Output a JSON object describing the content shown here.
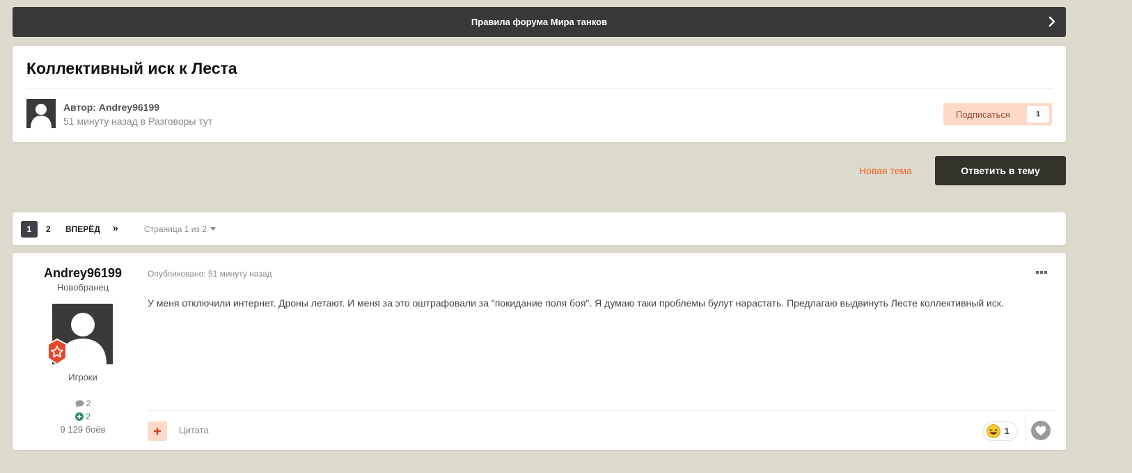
{
  "rules_bar": {
    "label": "Правила форума Мира танков"
  },
  "topic": {
    "title": "Коллективный иск к Леста",
    "author_line": "Автор: Andrey96199",
    "meta": "51 минуту назад в Разговоры тут",
    "subscribe_label": "Подписаться",
    "subscribe_count": "1"
  },
  "actions": {
    "new_topic": "Новая тема",
    "reply": "Ответить в тему"
  },
  "pagination": {
    "current": "1",
    "page2": "2",
    "next": "ВПЕРЁД",
    "last": "»",
    "info": "Страница 1 из 2"
  },
  "post": {
    "author": "Andrey96199",
    "rank": "Новобранец",
    "group": "Игроки",
    "posts_count": "2",
    "reputation": "2",
    "battles": "9 129 боёв",
    "published": "Опубликовано: 51 минуту назад",
    "body": "У меня отключили интернет.  Дроны летают. И меня за это оштрафовали за  \"покидание поля боя\". Я думаю таки проблемы булут нарастать. Предлагаю выдвинуть Лесте коллективный иск.",
    "quote_label": "Цитата",
    "reaction_count": "1"
  },
  "colors": {
    "accent": "#f26522",
    "dark_button": "#33322a",
    "subscribe_bg": "#fcd9c9",
    "page_bg": "#dcdacc"
  },
  "icons": {
    "rules_chevron": "chevron-right-icon",
    "avatar": "user-silhouette-icon",
    "badge": "star-shield-badge-icon",
    "comment": "comment-icon",
    "reputation": "plus-circle-icon",
    "menu": "ellipsis-icon",
    "multiquote": "plus-icon",
    "reaction": "laughing-emoji-icon",
    "like": "heart-icon"
  }
}
